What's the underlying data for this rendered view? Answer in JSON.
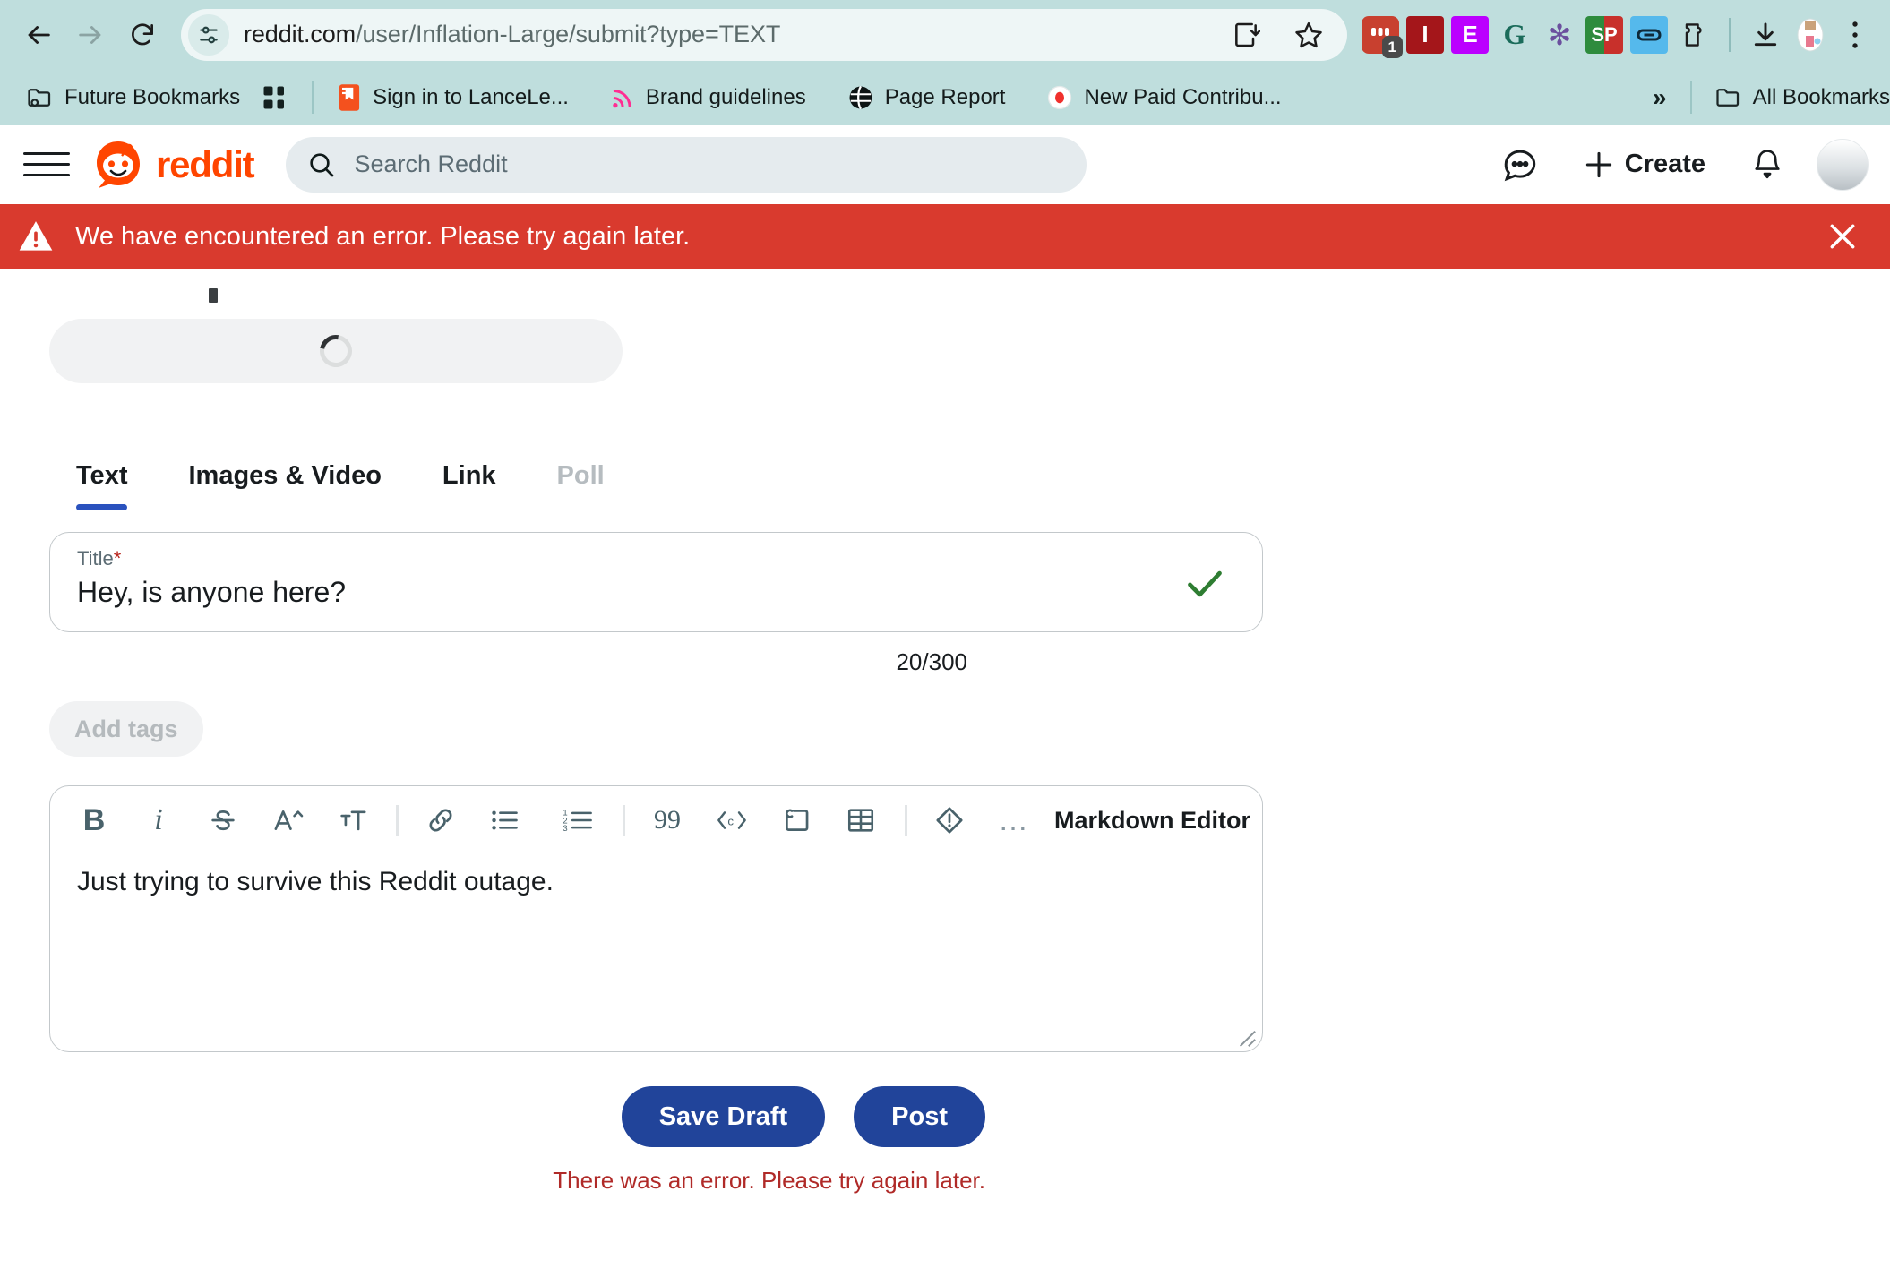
{
  "browser": {
    "nav": {
      "back_icon": "arrow-left-icon",
      "forward_icon": "arrow-right-icon",
      "reload_icon": "reload-icon"
    },
    "omnibox": {
      "site_info_icon": "tune-site-settings-icon",
      "url_prefix": "reddit.com",
      "url_suffix": "/user/Inflation-Large/submit?type=TEXT",
      "url_full": "reddit.com/user/Inflation-Large/submit?type=TEXT",
      "install_icon": "install-app-icon",
      "bookmark_icon": "star-icon"
    },
    "extensions": [
      {
        "name": "extension-red-square",
        "glyph": "",
        "bg": "#c8402f",
        "fg": "#ffffff",
        "badge": "1"
      },
      {
        "name": "extension-1password",
        "glyph": "I",
        "bg": "#a4161a",
        "fg": "#ffffff",
        "badge": ""
      },
      {
        "name": "extension-e-purple",
        "glyph": "E",
        "bg": "#bb00ff",
        "fg": "#ffffff",
        "badge": ""
      },
      {
        "name": "extension-grammarly",
        "glyph": "G",
        "bg": "#ffffff",
        "fg": "#1a6b5a",
        "badge": ""
      },
      {
        "name": "extension-flower",
        "glyph": "✻",
        "bg": "#ffffff",
        "fg": "#6b4f9e",
        "badge": ""
      },
      {
        "name": "extension-sp",
        "glyph": "SP",
        "bg": "#2e8b3d",
        "fg": "#ffffff",
        "badge": ""
      },
      {
        "name": "extension-link",
        "glyph": "⦵",
        "bg": "#55b9ec",
        "fg": "#0e2a3a",
        "badge": ""
      },
      {
        "name": "extension-puzzle",
        "glyph": "",
        "bg": "#ffffff",
        "fg": "#1c1c1c",
        "badge": ""
      }
    ],
    "downloads_icon": "download-icon",
    "profile_icon": "profile-avatar-icon",
    "menu_icon": "three-dot-menu-icon",
    "bookmarks": [
      {
        "label": "Future Bookmarks",
        "icon": "folder-gear-icon"
      },
      {
        "label": "",
        "icon": "apps-grid-icon"
      },
      {
        "label": "Sign in to LanceLe...",
        "icon": "orange-bookmark-icon"
      },
      {
        "label": "Brand guidelines",
        "icon": "rss-pink-icon"
      },
      {
        "label": "Page Report",
        "icon": "globe-black-icon"
      },
      {
        "label": "New Paid Contribu...",
        "icon": "record-red-icon"
      }
    ],
    "bookmarks_overflow": "»",
    "all_bookmarks_label": "All Bookmarks",
    "all_bookmarks_icon": "folder-icon"
  },
  "reddit_header": {
    "menu_icon": "hamburger-menu-icon",
    "logo_icon": "reddit-snoo-logo-icon",
    "brand": "reddit",
    "search_placeholder": "Search Reddit",
    "search_icon": "search-icon",
    "chat_icon": "chat-bubble-icon",
    "create_label": "Create",
    "create_icon": "plus-icon",
    "notifications_icon": "bell-icon",
    "avatar_icon": "user-avatar-icon",
    "brand_color": "#ff4500"
  },
  "error_banner": {
    "icon": "warning-triangle-icon",
    "message": "We have encountered an error. Please try again later.",
    "close_icon": "close-x-icon",
    "bg_color": "#d93a2e"
  },
  "composer": {
    "community_picker": {
      "state": "loading",
      "spinner_icon": "loading-spinner-icon"
    },
    "tabs": [
      {
        "label": "Text",
        "active": true,
        "disabled": false
      },
      {
        "label": "Images & Video",
        "active": false,
        "disabled": false
      },
      {
        "label": "Link",
        "active": false,
        "disabled": false
      },
      {
        "label": "Poll",
        "active": false,
        "disabled": true
      }
    ],
    "title": {
      "label": "Title",
      "required_marker": "*",
      "value": "Hey, is anyone here?",
      "valid_icon": "green-checkmark-icon",
      "counter": "20/300"
    },
    "add_tags_label": "Add tags",
    "editor": {
      "toolbar": [
        {
          "name": "bold-icon",
          "glyph": "B"
        },
        {
          "name": "italic-icon",
          "glyph": "i"
        },
        {
          "name": "strikethrough-icon",
          "glyph": "S"
        },
        {
          "name": "superscript-icon",
          "glyph": "A^"
        },
        {
          "name": "heading-icon",
          "glyph": "T"
        },
        {
          "name": "link-icon",
          "glyph": "link"
        },
        {
          "name": "bulleted-list-icon",
          "glyph": "ul"
        },
        {
          "name": "numbered-list-icon",
          "glyph": "ol"
        },
        {
          "name": "blockquote-icon",
          "glyph": "99"
        },
        {
          "name": "inline-code-icon",
          "glyph": "<c>"
        },
        {
          "name": "code-block-icon",
          "glyph": "cb"
        },
        {
          "name": "table-icon",
          "glyph": "table"
        },
        {
          "name": "spoiler-icon",
          "glyph": "!"
        },
        {
          "name": "more-options-icon",
          "glyph": "…"
        }
      ],
      "mode_label": "Markdown Editor",
      "body_text": "Just trying to survive this Reddit outage."
    },
    "buttons": {
      "save_draft": "Save Draft",
      "post": "Post",
      "primary_color": "#21449a"
    },
    "form_error": "There was an error. Please try again later.",
    "form_error_color": "#b02a28"
  }
}
